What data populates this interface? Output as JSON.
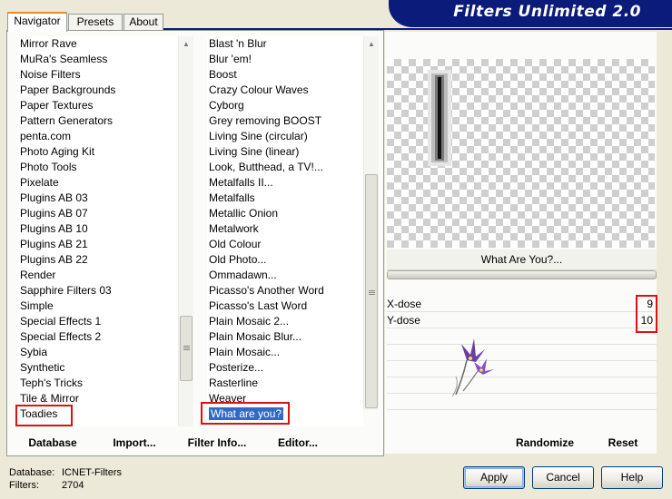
{
  "window": {
    "title": "Filters Unlimited 2.0"
  },
  "tabs": [
    {
      "label": "Navigator",
      "active": true
    },
    {
      "label": "Presets",
      "active": false
    },
    {
      "label": "About",
      "active": false
    }
  ],
  "categories": {
    "items": [
      "Mirror Rave",
      "MuRa's Seamless",
      "Noise Filters",
      "Paper Backgrounds",
      "Paper Textures",
      "Pattern Generators",
      "penta.com",
      "Photo Aging Kit",
      "Photo Tools",
      "Pixelate",
      "Plugins AB 03",
      "Plugins AB 07",
      "Plugins AB 10",
      "Plugins AB 21",
      "Plugins AB 22",
      "Render",
      "Sapphire Filters 03",
      "Simple",
      "Special Effects 1",
      "Special Effects 2",
      "Sybia",
      "Synthetic",
      "Teph's Tricks",
      "Tile & Mirror",
      "Toadies"
    ],
    "highlighted": "Toadies"
  },
  "filters": {
    "items": [
      "Blast 'n Blur",
      "Blur 'em!",
      "Boost",
      "Crazy Colour Waves",
      "Cyborg",
      "Grey removing BOOST",
      "Living Sine (circular)",
      "Living Sine (linear)",
      "Look, Butthead, a TV!...",
      "Metalfalls II...",
      "Metalfalls",
      "Metallic Onion",
      "Metalwork",
      "Old Colour",
      "Old Photo...",
      "Ommadawn...",
      "Picasso's Another Word",
      "Picasso's Last Word",
      "Plain Mosaic 2...",
      "Plain Mosaic Blur...",
      "Plain Mosaic...",
      "Posterize...",
      "Rasterline",
      "Weaver",
      "What are you?"
    ],
    "selected": "What are you?"
  },
  "preview": {
    "filter_name": "What Are You?..."
  },
  "parameters": [
    {
      "name": "X-dose",
      "value": "9"
    },
    {
      "name": "Y-dose",
      "value": "10"
    }
  ],
  "toolbar_left": {
    "database": "Database",
    "import": "Import...",
    "filter_info": "Filter Info...",
    "editor": "Editor..."
  },
  "toolbar_right": {
    "randomize": "Randomize",
    "reset": "Reset"
  },
  "status": {
    "database_label": "Database:",
    "database_value": "ICNET-Filters",
    "filters_label": "Filters:",
    "filters_value": "2704"
  },
  "buttons": {
    "apply": "Apply",
    "cancel": "Cancel",
    "help": "Help"
  },
  "colors": {
    "banner": "#0b1b7a",
    "selection": "#316ac5",
    "highlight_box": "#dd1111"
  }
}
